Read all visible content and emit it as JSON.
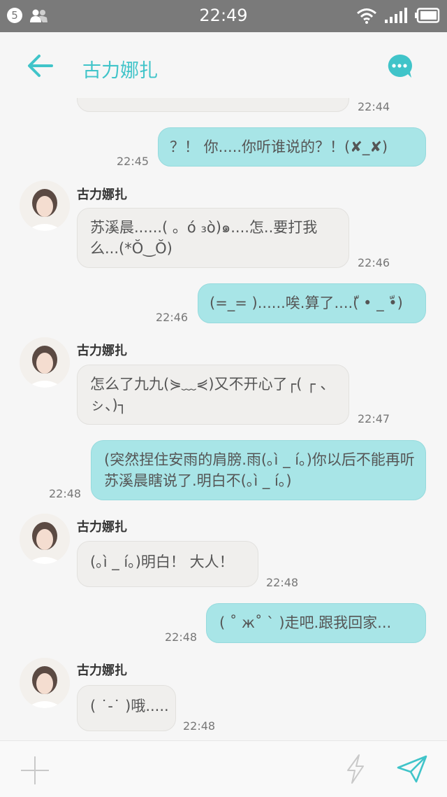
{
  "status_bar": {
    "notification_count": "5",
    "time": "22:49"
  },
  "header": {
    "title": "古力娜扎"
  },
  "partial_message": {
    "time": "22:44"
  },
  "messages": [
    {
      "dir": "out",
      "text": "？！ 你.....你听谁说的？！(✘_✘)",
      "time": "22:45"
    },
    {
      "dir": "in",
      "name": "古力娜扎",
      "text": "苏溪晨......( 。ό ₃ὸ)๑....怎..要打我么...(*Ŏ‿Ŏ)",
      "time": "22:46"
    },
    {
      "dir": "out",
      "text": "(=_= )......唉.算了....(ّ • _ •ّ)",
      "time": "22:46"
    },
    {
      "dir": "in",
      "name": "古力娜扎",
      "text": "怎么了九九(⋟﹏⋞)又不开心了┌( ┌ 、ㇱ、)┐",
      "time": "22:47"
    },
    {
      "dir": "out",
      "text": "(突然捏住安雨的肩膀.雨(｡ì _ í｡)你以后不能再听苏溪晨瞎说了.明白不(｡ì _ í｡)",
      "time": "22:48"
    },
    {
      "dir": "in",
      "name": "古力娜扎",
      "text": "(｡ì _ í｡)明白！ 大人！",
      "time": "22:48"
    },
    {
      "dir": "out",
      "text": "( ˚ ж˚ ` )走吧.跟我回家...",
      "time": "22:48"
    },
    {
      "dir": "in",
      "name": "古力娜扎",
      "text": "( ˙-˙ )哦.....",
      "time": "22:48"
    }
  ],
  "colors": {
    "accent": "#40c4c9",
    "outgoing_bubble": "#a8e5e7",
    "incoming_bubble": "#f0efed",
    "status_bar": "#7a7a7a"
  },
  "icons": {
    "back": "arrow-left-icon",
    "chat": "chat-bubble-icon",
    "add": "plus-icon",
    "quick": "lightning-icon",
    "send": "send-icon"
  }
}
